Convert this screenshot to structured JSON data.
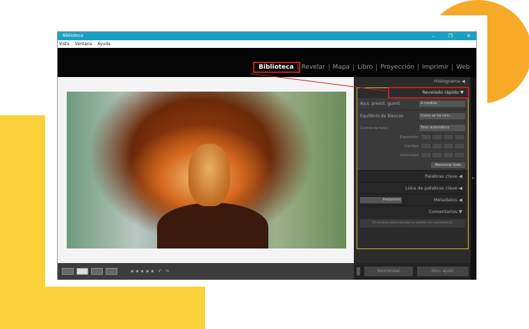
{
  "window": {
    "title": "- Biblioteca",
    "minimize": "–",
    "restore": "❐",
    "close": "✕"
  },
  "menu": [
    "Vista",
    "Ventana",
    "Ayuda"
  ],
  "modules": [
    "Biblioteca",
    "Revelar",
    "Mapa",
    "Libro",
    "Proyección",
    "Imprimir",
    "Web"
  ],
  "panel": {
    "histogram": "Histograma ◀",
    "quick_develop": "Revelado rápido ▼",
    "preset_label": "Ajus. preest. guard.",
    "preset_value": "A medida",
    "wb_label": "Equilibrio de blancos",
    "wb_value": "Como se ha tom...",
    "tone_label": "Control de tono",
    "tone_value": "Tono automático",
    "exposure": "Exposición",
    "clarity": "Claridad",
    "vibrance": "Intensidad",
    "reset": "Restaurar todo",
    "keywords": "Palabras clave ◀",
    "keyword_list": "Lista de palabras clave ◀",
    "metadata_select": "Predeterm.",
    "metadata": "Metadatos ◀",
    "comments": "Comentarios ▼",
    "comments_note": "El servicio seleccionado no admite los comentarios"
  },
  "toolbar": {
    "stars": "★★★★★",
    "rotate_left": "↶",
    "rotate_right": "↷"
  },
  "buttons": {
    "sync": "Sincronizar",
    "sync_settings": "Sinc. ajust."
  }
}
